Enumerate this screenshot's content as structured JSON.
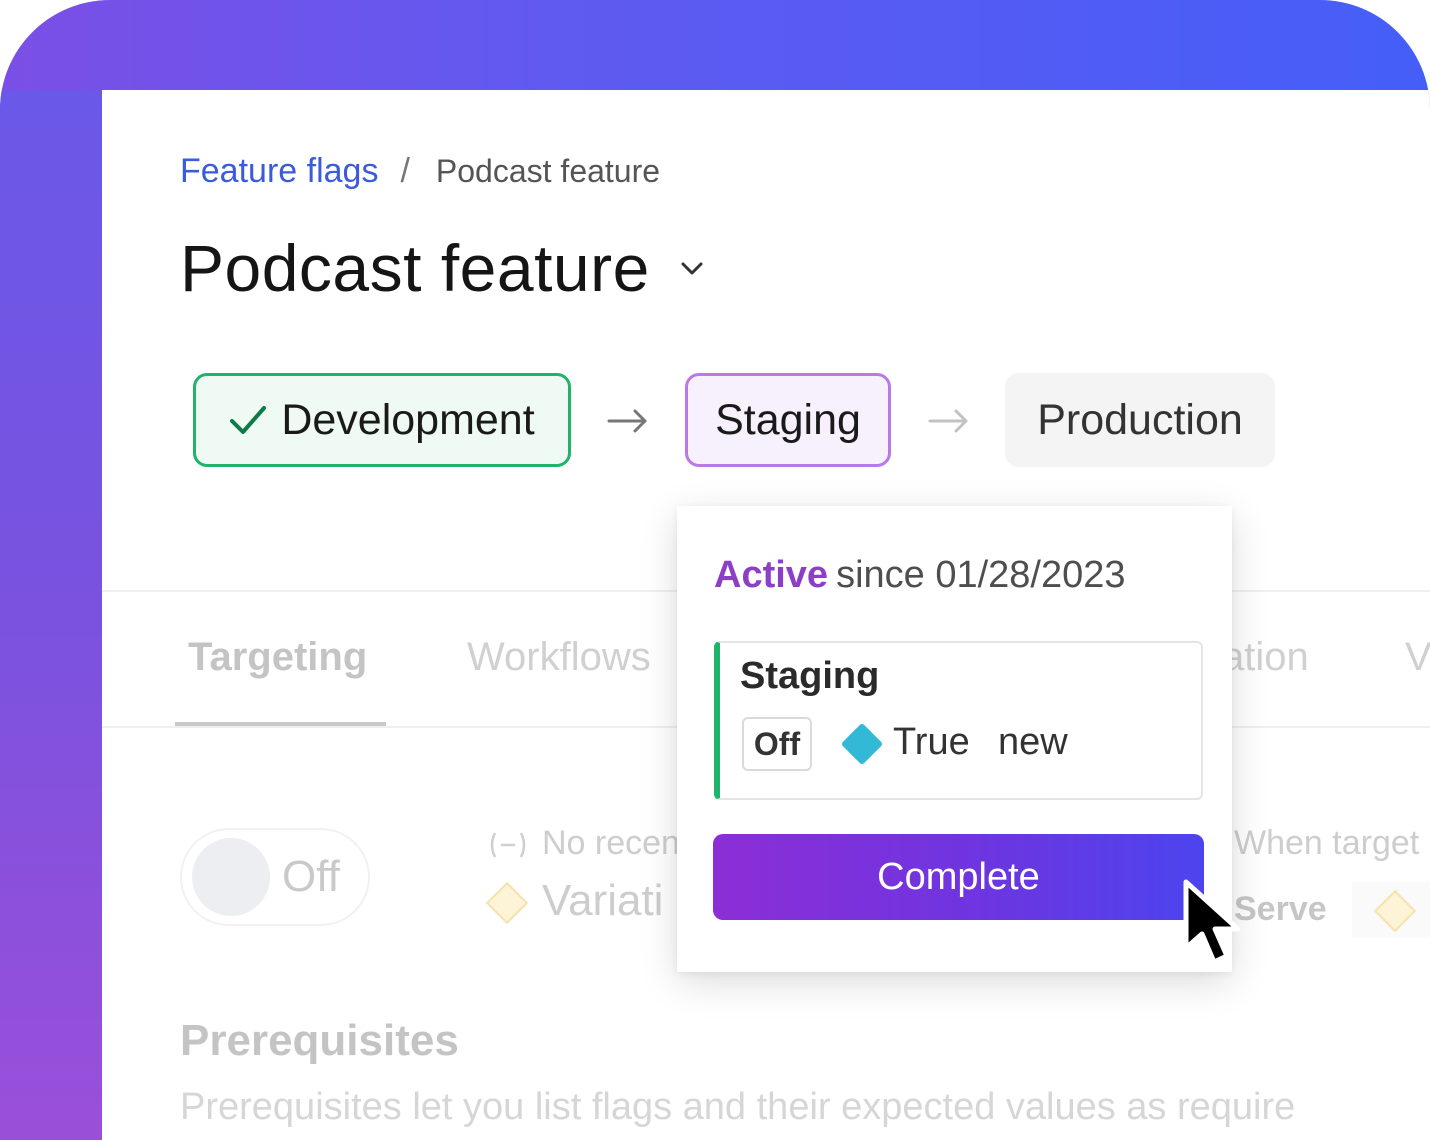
{
  "breadcrumb": {
    "parent": "Feature flags",
    "separator": "/",
    "current": "Podcast feature"
  },
  "page": {
    "title": "Podcast feature"
  },
  "environments": {
    "development": "Development",
    "staging": "Staging",
    "production": "Production"
  },
  "tabs": {
    "targeting": "Targeting",
    "workflows": "Workflows",
    "partial_a": "ation",
    "partial_b": "V"
  },
  "targeting": {
    "toggle_label": "Off",
    "no_recent": "No recen",
    "variation": "Variati",
    "when_target": "When target",
    "serve": "Serve"
  },
  "prerequisites": {
    "heading": "Prerequisites",
    "description": "Prerequisites let you list flags and their expected values as require"
  },
  "popover": {
    "status_active": "Active",
    "status_since": "since 01/28/2023",
    "card_title": "Staging",
    "off_badge": "Off",
    "variation_name": "True",
    "variation_value": "new",
    "complete_button": "Complete"
  },
  "colors": {
    "accent_purple": "#8b3fc9",
    "success_green": "#1fb36b",
    "link_blue": "#3b5bdb",
    "variation_cyan": "#33b9d6"
  },
  "icons": {
    "title_dropdown": "chevron-down-icon",
    "development_status": "check-icon",
    "pipeline_arrow": "arrow-right-icon",
    "variation_marker": "diamond-icon",
    "cursor": "mouse-pointer-icon"
  }
}
